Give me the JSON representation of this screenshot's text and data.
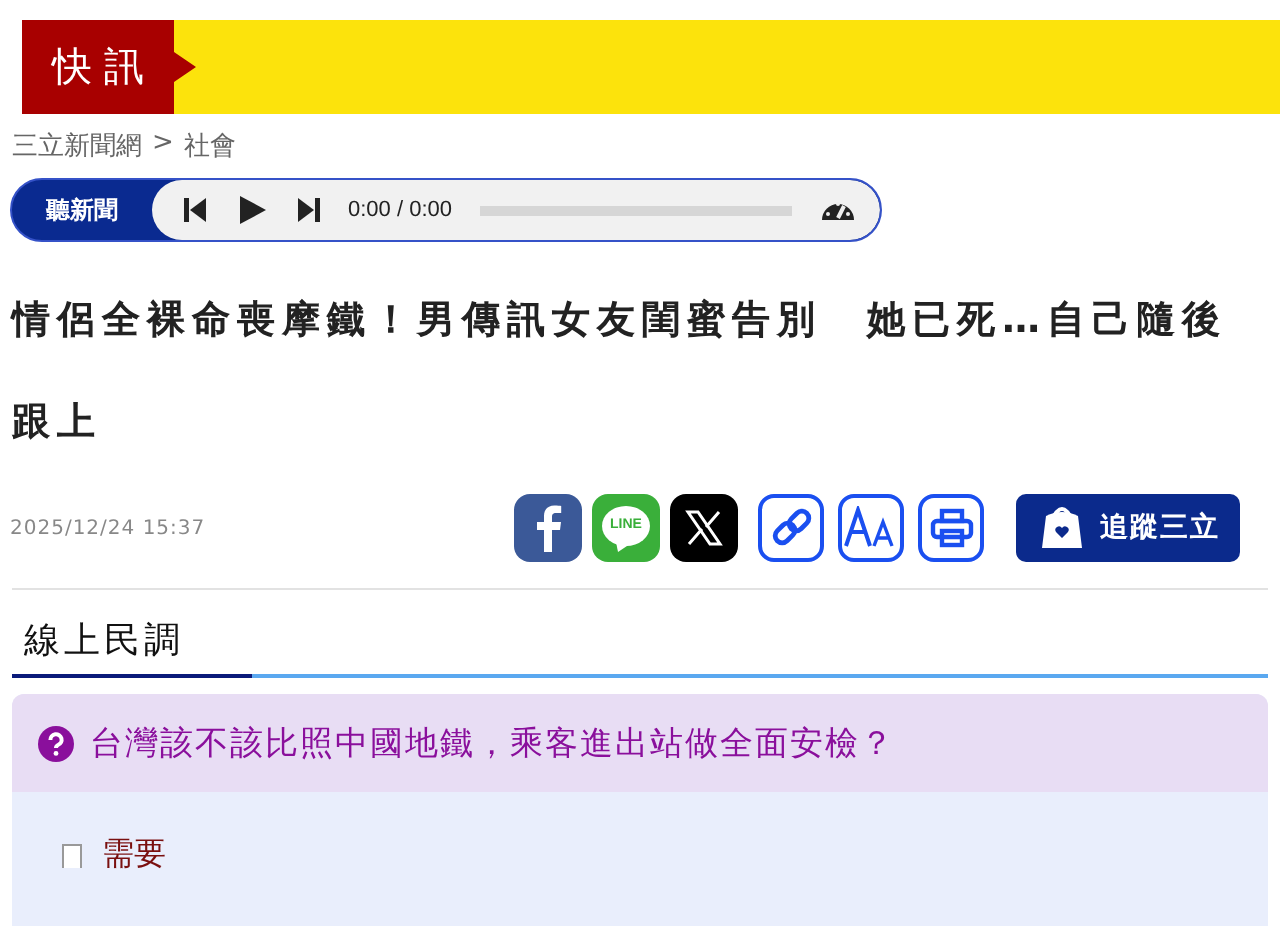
{
  "flash_banner": {
    "label": "快 訊"
  },
  "breadcrumb": {
    "site": "三立新聞網",
    "separator": ">",
    "section": "社會"
  },
  "audio_player": {
    "label": "聽新聞",
    "time": "0:00 / 0:00"
  },
  "headline": "情侶全裸命喪摩鐵！男傳訊女友閨蜜告別　她已死…自己隨後跟上",
  "meta": {
    "date": "2025/12/24  15:37"
  },
  "share_buttons": [
    {
      "kind": "facebook"
    },
    {
      "kind": "line",
      "label": "LINE"
    },
    {
      "kind": "x"
    },
    {
      "kind": "link"
    },
    {
      "kind": "font"
    },
    {
      "kind": "print"
    }
  ],
  "follow_button": {
    "label": "追蹤三立"
  },
  "poll": {
    "title": "線上民調",
    "question": "台灣該不該比照中國地鐵，乘客進出站做全面安檢？",
    "options": [
      {
        "label": "需要",
        "checked": false
      }
    ]
  }
}
